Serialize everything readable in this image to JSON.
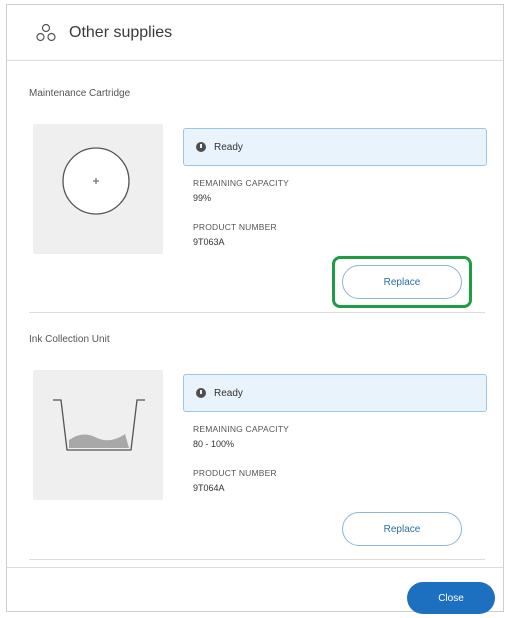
{
  "dialog": {
    "title": "Other supplies",
    "title_icon": "supplies-icon"
  },
  "supplies": [
    {
      "name": "Maintenance Cartridge",
      "image_icon": "maintenance-cartridge-icon",
      "status": "Ready",
      "status_icon": "info-icon",
      "capacity_label": "REMAINING CAPACITY",
      "capacity_value": "99%",
      "product_label": "PRODUCT NUMBER",
      "product_value": "9T063A",
      "replace_label": "Replace"
    },
    {
      "name": "Ink Collection Unit",
      "image_icon": "ink-collection-unit-icon",
      "status": "Ready",
      "status_icon": "info-icon",
      "capacity_label": "REMAINING CAPACITY",
      "capacity_value": "80 - 100%",
      "product_label": "PRODUCT NUMBER",
      "product_value": "9T064A",
      "replace_label": "Replace"
    }
  ],
  "footer": {
    "close_label": "Close"
  },
  "colors": {
    "accent": "#1d6fbf",
    "highlight": "#1f9d45",
    "status_bg": "#e9f3fb"
  }
}
